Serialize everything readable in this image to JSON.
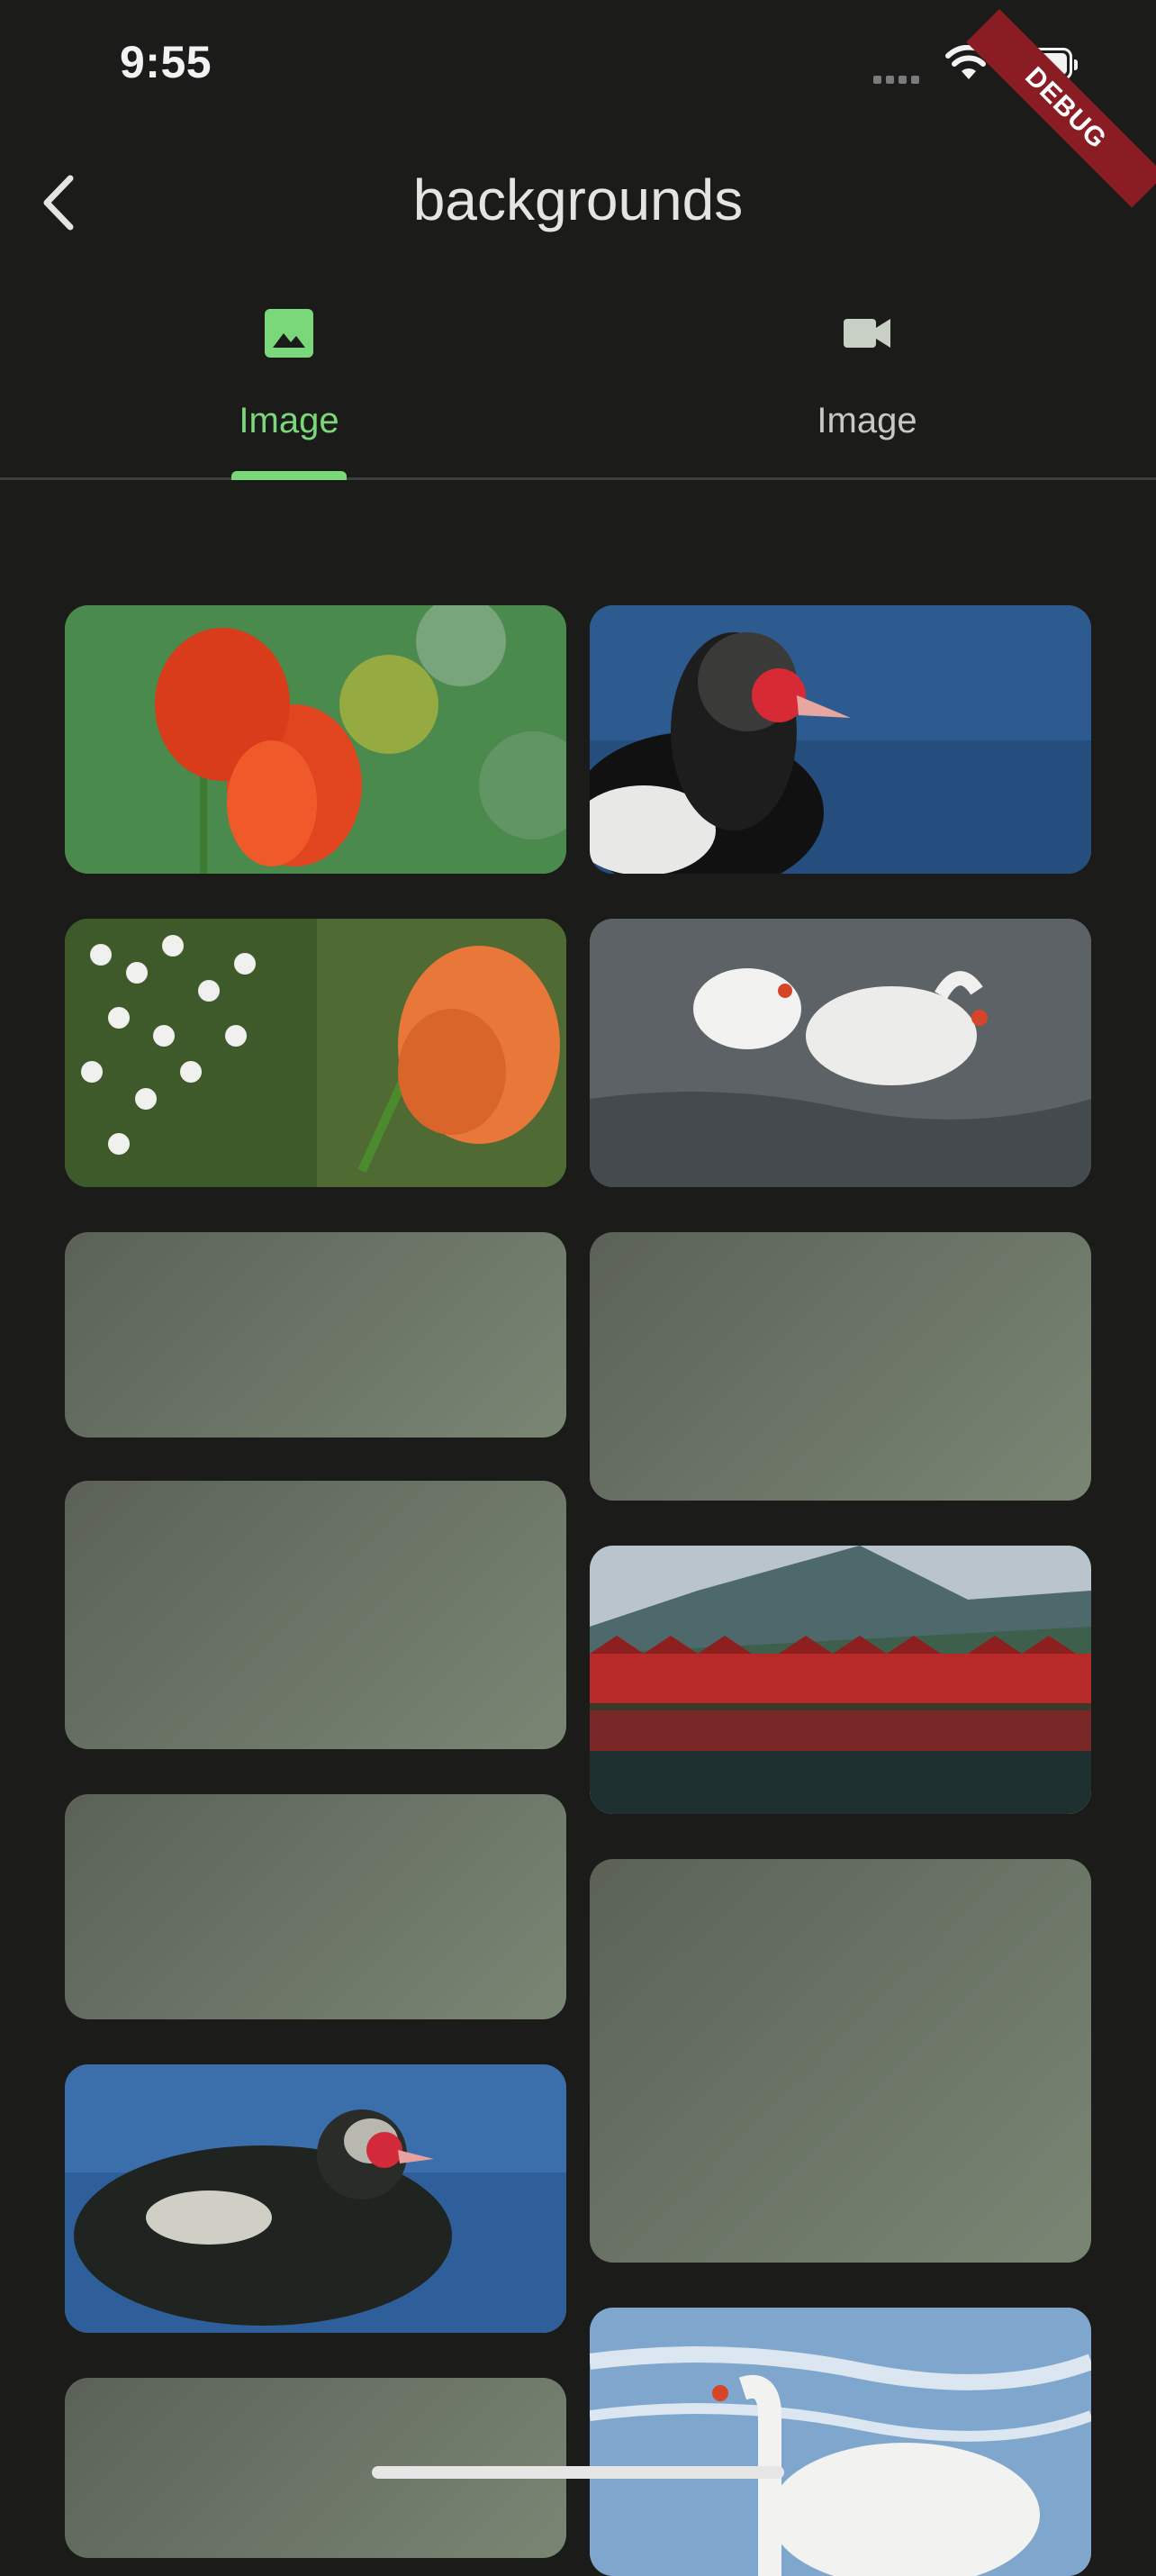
{
  "status_bar": {
    "time": "9:55",
    "debug_label": "DEBUG"
  },
  "app_bar": {
    "title": "backgrounds"
  },
  "tabs": [
    {
      "label": "Image",
      "icon": "image-icon",
      "selected": true
    },
    {
      "label": "Image",
      "icon": "videocam-icon",
      "selected": false
    }
  ],
  "colors": {
    "accent": "#7ad77a",
    "background": "#1b1c1a",
    "placeholder": "#6b7466"
  },
  "grid": {
    "items": [
      {
        "type": "image",
        "subject": "tulips"
      },
      {
        "type": "image",
        "subject": "muscovy-duck"
      },
      {
        "type": "image",
        "subject": "rose-and-babys-breath"
      },
      {
        "type": "image",
        "subject": "swans"
      },
      {
        "type": "placeholder"
      },
      {
        "type": "placeholder"
      },
      {
        "type": "placeholder"
      },
      {
        "type": "image",
        "subject": "red-boathouses"
      },
      {
        "type": "placeholder"
      },
      {
        "type": "placeholder"
      },
      {
        "type": "image",
        "subject": "muscovy-duck-2"
      },
      {
        "type": "image",
        "subject": "swan"
      },
      {
        "type": "placeholder"
      }
    ]
  }
}
